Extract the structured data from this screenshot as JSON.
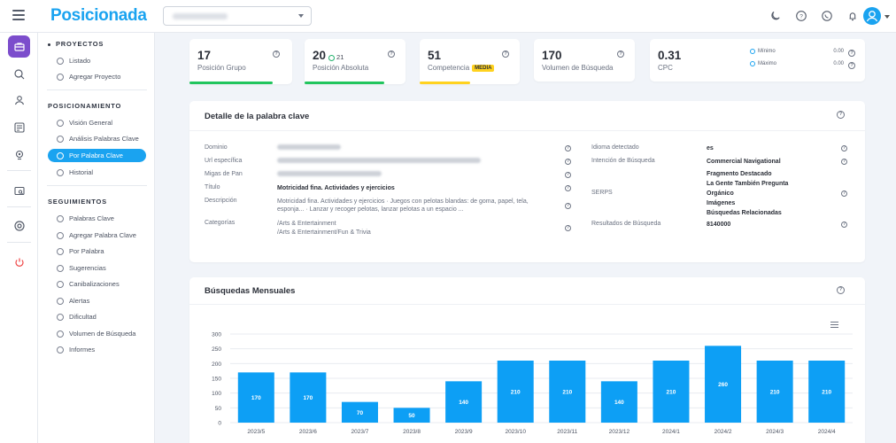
{
  "header": {
    "logo": "Posicionada",
    "site_select_value": ""
  },
  "sidebar": {
    "sections": [
      {
        "title": "PROYECTOS",
        "items": [
          "Listado",
          "Agregar Proyecto"
        ]
      },
      {
        "title": "POSICIONAMIENTO",
        "items": [
          "Visión General",
          "Análisis Palabras Clave",
          "Por Palabra Clave",
          "Historial"
        ]
      },
      {
        "title": "SEGUIMIENTOS",
        "items": [
          "Palabras Clave",
          "Agregar Palabra Clave",
          "Por Palabra",
          "Sugerencias",
          "Canibalizaciones",
          "Alertas",
          "Dificultad",
          "Volumen de Búsqueda",
          "Informes"
        ]
      }
    ],
    "active_item": "Por Palabra Clave"
  },
  "stats": {
    "grupo": {
      "value": "17",
      "label": "Posición Grupo",
      "bar_color": "#22c55e"
    },
    "absoluta": {
      "value": "20",
      "delta": "21",
      "label": "Posición Absoluta",
      "bar_color": "#22c55e"
    },
    "competencia": {
      "value": "51",
      "label": "Competencia",
      "badge": "MEDIA",
      "bar_color": "#ffd21f"
    },
    "volumen": {
      "value": "170",
      "label": "Volumen de Búsqueda"
    },
    "cpc": {
      "value": "0.31",
      "label": "CPC",
      "min_label": "Mínimo",
      "min_value": "0.00",
      "max_label": "Máximo",
      "max_value": "0.00"
    }
  },
  "detail": {
    "title": "Detalle de la palabra clave",
    "left": {
      "dominio_label": "Dominio",
      "url_label": "Url específica",
      "migas_label": "Migas de Pan",
      "titulo_label": "Título",
      "titulo_value": "Motricidad fina. Actividades y ejercicios",
      "descripcion_label": "Descripción",
      "descripcion_value": "Motricidad fina. Actividades y ejercicios · Juegos con pelotas blandas: de goma, papel, tela, esponja... · Lanzar y recoger pelotas, lanzar pelotas a un espacio ...",
      "categorias_label": "Categorías",
      "categoria_1": "/Arts & Entertainment",
      "categoria_2": "/Arts & Entertainment/Fun & Trivia"
    },
    "right": {
      "idioma_label": "Idioma detectado",
      "idioma_value": "es",
      "intencion_label": "Intención de Búsqueda",
      "intencion_value": "Commercial Navigational",
      "serps_label": "SERPS",
      "serps_values": [
        "Fragmento Destacado",
        "La Gente También Pregunta",
        "Orgánico",
        "Imágenes",
        "Búsquedas Relacionadas"
      ],
      "resultados_label": "Resultados de Búsqueda",
      "resultados_value": "8140000"
    }
  },
  "monthly": {
    "title": "Búsquedas Mensuales"
  },
  "chart_data": {
    "type": "bar",
    "title": "Búsquedas Mensuales",
    "categories": [
      "2023/5",
      "2023/6",
      "2023/7",
      "2023/8",
      "2023/9",
      "2023/10",
      "2023/11",
      "2023/12",
      "2024/1",
      "2024/2",
      "2024/3",
      "2024/4"
    ],
    "values": [
      170,
      170,
      70,
      50,
      140,
      210,
      210,
      140,
      210,
      260,
      210,
      210
    ],
    "ylim": [
      0,
      300
    ],
    "yticks": [
      0,
      50,
      100,
      150,
      200,
      250,
      300
    ],
    "bar_color": "#0d9ff5",
    "label_color": "#ffffff",
    "grid": true
  }
}
